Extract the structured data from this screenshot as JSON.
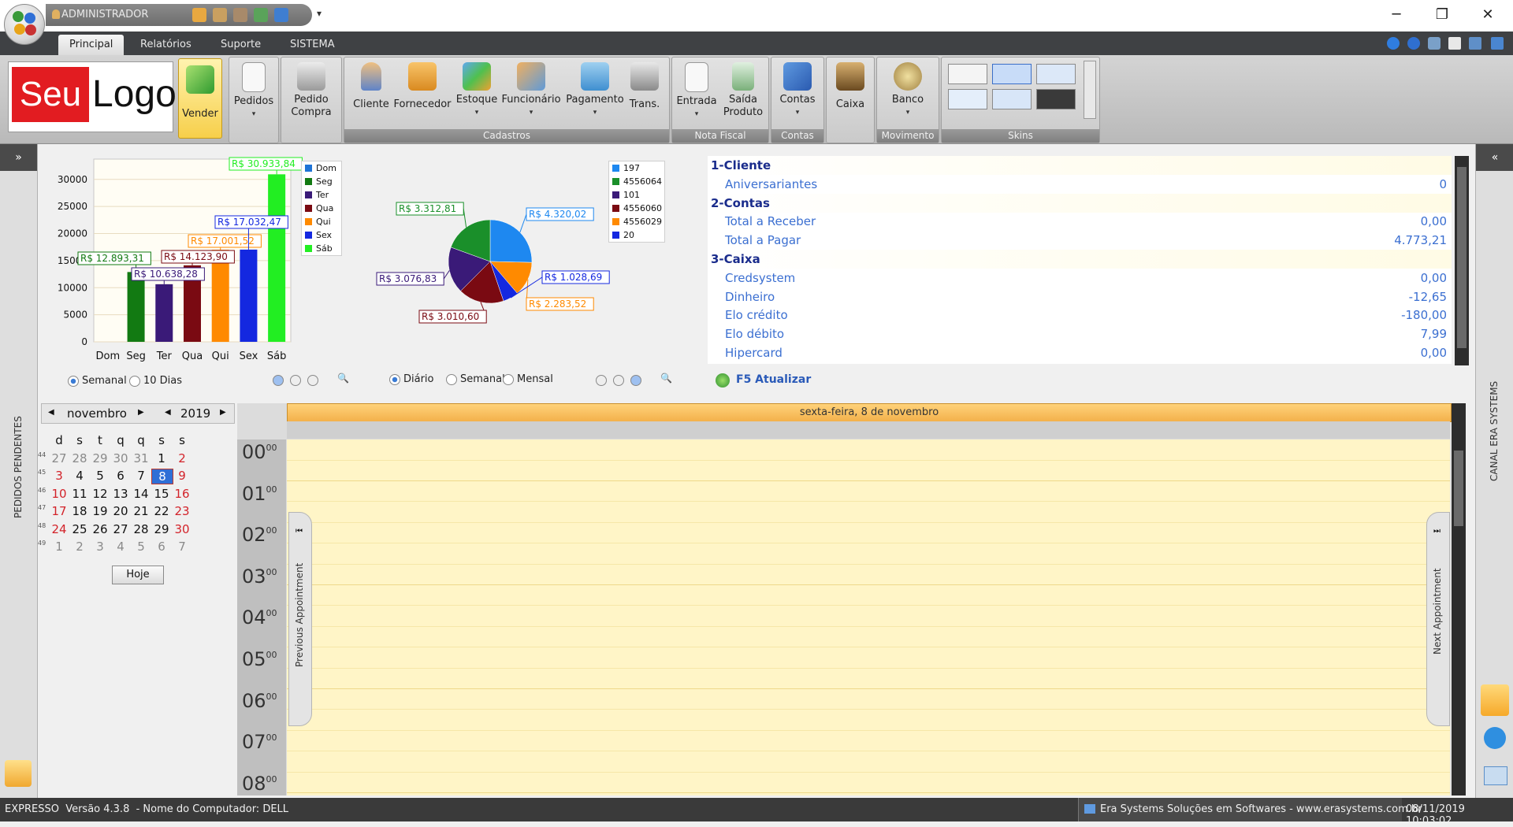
{
  "titlebar": {
    "user": "ADMINISTRADOR",
    "dropdown": "▾",
    "minimize": "─",
    "restore": "❐",
    "close": "✕"
  },
  "tabs": [
    "Principal",
    "Relatórios",
    "Suporte",
    "SISTEMA"
  ],
  "ribbon": {
    "logo_red": "Seu",
    "logo_black": "Logo",
    "vender": "Vender",
    "pedidos": "Pedidos",
    "pedido_compra_1": "Pedido",
    "pedido_compra_2": "Compra",
    "cliente": "Cliente",
    "fornecedor": "Fornecedor",
    "estoque": "Estoque",
    "funcionario": "Funcionário",
    "pagamento": "Pagamento",
    "trans": "Trans.",
    "entrada": "Entrada",
    "saida_1": "Saída",
    "saida_2": "Produto",
    "contas": "Contas",
    "caixa": "Caixa",
    "banco": "Banco",
    "groups": {
      "cadastros": "Cadastros",
      "nota_fiscal": "Nota Fiscal",
      "contas": "Contas",
      "movimento": "Movimento",
      "skins": "Skins"
    },
    "drop": "▾"
  },
  "left_panel": {
    "expand": "»",
    "label": "PEDIDOS PENDENTES"
  },
  "right_panel": {
    "collapse": "«",
    "label": "CANAL ERA SYSTEMS"
  },
  "chart_data": [
    {
      "type": "bar",
      "categories": [
        "Dom",
        "Seg",
        "Ter",
        "Qua",
        "Qui",
        "Sex",
        "Sáb"
      ],
      "values": [
        0,
        12893.31,
        10638.28,
        14123.9,
        17001.52,
        17032.47,
        30933.84
      ],
      "labels": [
        "",
        "R$ 12.893,31",
        "R$ 10.638,28",
        "R$ 14.123,90",
        "R$ 17.001,52",
        "R$ 17.032,47",
        "R$ 30.933,84"
      ],
      "colors": [
        "#1e73d6",
        "#127a12",
        "#3a1a78",
        "#7a0a12",
        "#ff8a00",
        "#1428e0",
        "#22ee22"
      ],
      "yticks": [
        0,
        5000,
        10000,
        15000,
        20000,
        25000,
        30000
      ],
      "ylim": [
        0,
        32000
      ],
      "legend": [
        "Dom",
        "Seg",
        "Ter",
        "Qua",
        "Qui",
        "Sex",
        "Sáb"
      ],
      "legend_position": "right",
      "grid": true
    },
    {
      "type": "pie",
      "categories": [
        "197",
        "4556064",
        "101",
        "4556060",
        "4556029",
        "20"
      ],
      "values": [
        4320.02,
        3312.81,
        3076.83,
        3010.6,
        2283.52,
        1028.69
      ],
      "labels": [
        "R$ 4.320,02",
        "R$ 3.312,81",
        "R$ 3.076,83",
        "R$ 3.010,60",
        "R$ 2.283,52",
        "R$ 1.028,69"
      ],
      "colors": [
        "#1e88f0",
        "#1a8f2a",
        "#3a1a78",
        "#7a0a12",
        "#ff8a00",
        "#1428e0"
      ],
      "legend": [
        "197",
        "4556064",
        "101",
        "4556060",
        "4556029",
        "20"
      ],
      "legend_position": "right"
    }
  ],
  "bar_controls": {
    "semanal": "Semanal",
    "dez_dias": "10 Dias",
    "zoom": "🔍"
  },
  "pie_controls": {
    "diario": "Diário",
    "semanal": "Semanal",
    "mensal": "Mensal",
    "zoom": "🔍"
  },
  "summary": {
    "rows": [
      {
        "k": "1-Cliente",
        "v": "",
        "type": "h"
      },
      {
        "k": "Aniversariantes",
        "v": "0",
        "type": "i"
      },
      {
        "k": "2-Contas",
        "v": "",
        "type": "h"
      },
      {
        "k": "Total a Receber",
        "v": "0,00",
        "type": "i"
      },
      {
        "k": "Total a Pagar",
        "v": "4.773,21",
        "type": "i"
      },
      {
        "k": "3-Caixa",
        "v": "",
        "type": "h"
      },
      {
        "k": "Credsystem",
        "v": "0,00",
        "type": "i"
      },
      {
        "k": "Dinheiro",
        "v": "-12,65",
        "type": "i"
      },
      {
        "k": "Elo crédito",
        "v": "-180,00",
        "type": "i"
      },
      {
        "k": "Elo débito",
        "v": "7,99",
        "type": "i"
      },
      {
        "k": "Hipercard",
        "v": "0,00",
        "type": "i"
      }
    ],
    "refresh": "F5 Atualizar"
  },
  "calendar": {
    "month": "novembro",
    "year": "2019",
    "prev": "◀",
    "next": "▶",
    "weekdays": [
      "d",
      "s",
      "t",
      "q",
      "q",
      "s",
      "s"
    ],
    "weeks": [
      {
        "wk": "44",
        "days": [
          "27",
          "28",
          "29",
          "30",
          "31",
          "1",
          "2"
        ]
      },
      {
        "wk": "45",
        "days": [
          "3",
          "4",
          "5",
          "6",
          "7",
          "8",
          "9"
        ]
      },
      {
        "wk": "46",
        "days": [
          "10",
          "11",
          "12",
          "13",
          "14",
          "15",
          "16"
        ]
      },
      {
        "wk": "47",
        "days": [
          "17",
          "18",
          "19",
          "20",
          "21",
          "22",
          "23"
        ]
      },
      {
        "wk": "48",
        "days": [
          "24",
          "25",
          "26",
          "27",
          "28",
          "29",
          "30"
        ]
      },
      {
        "wk": "49",
        "days": [
          "1",
          "2",
          "3",
          "4",
          "5",
          "6",
          "7"
        ]
      }
    ],
    "today": "Hoje",
    "selected": "8"
  },
  "scheduler": {
    "day_header": "sexta-feira, 8 de novembro",
    "hours": [
      "00",
      "01",
      "02",
      "03",
      "04",
      "05",
      "06",
      "07",
      "08"
    ],
    "minutes": "00",
    "prev_appt": "Previous Appointment",
    "next_appt": "Next Appointment"
  },
  "statusbar": {
    "left": "EXPRESSO  Versão 4.3.8  - Nome do Computador: DELL",
    "company": "Era Systems Soluções em Softwares - www.erasystems.com.br",
    "datetime": "08/11/2019 10:03:02"
  }
}
